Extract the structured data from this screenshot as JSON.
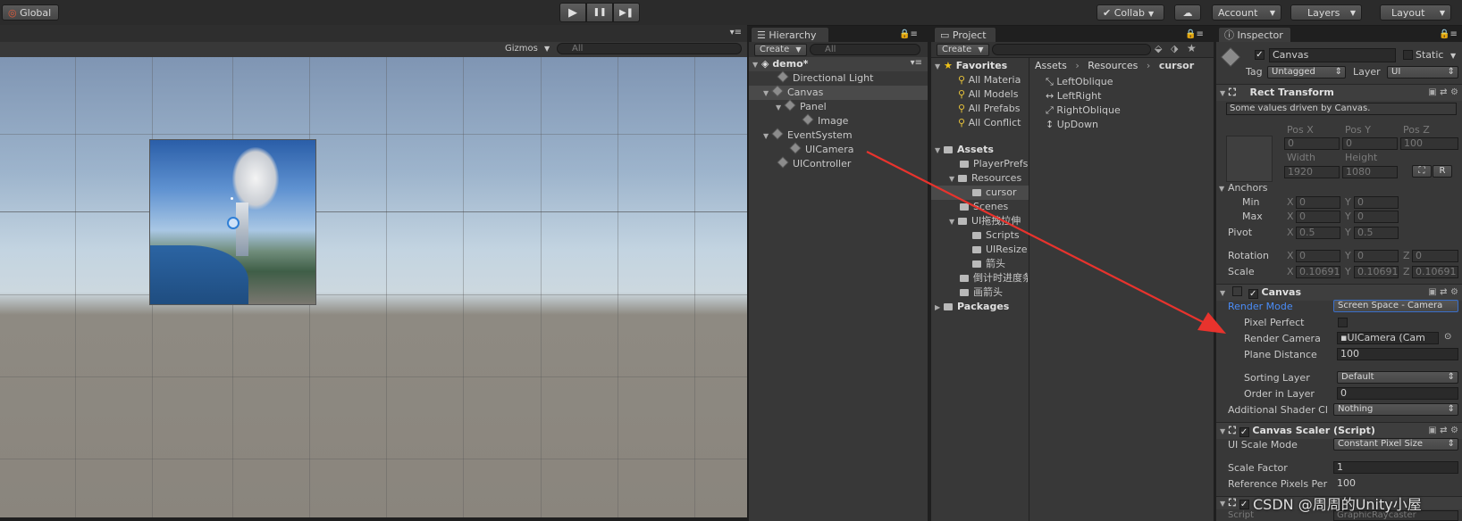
{
  "toolbar": {
    "global_label": "Global",
    "collab_label": "Collab",
    "account_label": "Account",
    "layers_label": "Layers",
    "layout_label": "Layout",
    "play_glyph": "▶",
    "pause_glyph": "❚❚",
    "step_glyph": "▶❚"
  },
  "scene": {
    "gizmos_label": "Gizmos",
    "search_placeholder": "All"
  },
  "hierarchy": {
    "tab_label": "Hierarchy",
    "create_label": "Create",
    "search_placeholder": "All",
    "scene_name": "demo*",
    "items": [
      "Directional Light",
      "Canvas",
      "Panel",
      "Image",
      "EventSystem",
      "UICamera",
      "UIController"
    ]
  },
  "project": {
    "tab_label": "Project",
    "create_label": "Create",
    "favorites_label": "Favorites",
    "favorites": [
      "All Materia",
      "All Models",
      "All Prefabs",
      "All Conflict"
    ],
    "assets_label": "Assets",
    "asset_folders": [
      "PlayerPrefs",
      "Resources",
      "cursor",
      "Scenes",
      "UI拖拽拉伸",
      "Scripts",
      "UIResize",
      "箭头",
      "倒计时进度条",
      "画箭头"
    ],
    "packages_label": "Packages",
    "breadcrumb": [
      "Assets",
      "Resources",
      "cursor"
    ],
    "files": [
      "LeftOblique",
      "LeftRight",
      "RightOblique",
      "UpDown"
    ]
  },
  "inspector": {
    "tab_label": "Inspector",
    "object_name": "Canvas",
    "static_label": "Static",
    "tag_label": "Tag",
    "tag_value": "Untagged",
    "layer_label": "Layer",
    "layer_value": "UI",
    "rect_transform": {
      "title": "Rect Transform",
      "driven_note": "Some values driven by Canvas.",
      "pos_x_label": "Pos X",
      "pos_y_label": "Pos Y",
      "pos_z_label": "Pos Z",
      "pos_x": "0",
      "pos_y": "0",
      "pos_z": "100",
      "width_label": "Width",
      "height_label": "Height",
      "width": "1920",
      "height": "1080",
      "r_label": "R",
      "anchors_label": "Anchors",
      "min_label": "Min",
      "max_label": "Max",
      "min_x": "0",
      "min_y": "0",
      "max_x": "0",
      "max_y": "0",
      "pivot_label": "Pivot",
      "pivot_x": "0.5",
      "pivot_y": "0.5",
      "rotation_label": "Rotation",
      "rot_x": "0",
      "rot_y": "0",
      "rot_z": "0",
      "scale_label": "Scale",
      "scale_x": "0.10691",
      "scale_y": "0.10691",
      "scale_z": "0.10691",
      "x_label": "X",
      "y_label": "Y",
      "z_label": "Z"
    },
    "canvas": {
      "title": "Canvas",
      "render_mode_label": "Render Mode",
      "render_mode_value": "Screen Space - Camera",
      "pixel_perfect_label": "Pixel Perfect",
      "render_camera_label": "Render Camera",
      "render_camera_value": "UICamera (Cam",
      "plane_distance_label": "Plane Distance",
      "plane_distance_value": "100",
      "sorting_layer_label": "Sorting Layer",
      "sorting_layer_value": "Default",
      "order_in_layer_label": "Order in Layer",
      "order_in_layer_value": "0",
      "shader_channels_label": "Additional Shader Cl",
      "shader_channels_value": "Nothing"
    },
    "canvas_scaler": {
      "title": "Canvas Scaler (Script)",
      "ui_scale_mode_label": "UI Scale Mode",
      "ui_scale_mode_value": "Constant Pixel Size",
      "scale_factor_label": "Scale Factor",
      "scale_factor_value": "1",
      "ref_pixels_label": "Reference Pixels Per",
      "ref_pixels_value": "100"
    },
    "graphic_raycaster": {
      "script_label": "Script",
      "script_value": "GraphicRaycaster"
    }
  },
  "watermark": "CSDN @周周的Unity小屋",
  "colors": {
    "accent_arrow": "#e8332d",
    "selection": "#4d4d4d",
    "link_label": "#4a8cf7"
  }
}
